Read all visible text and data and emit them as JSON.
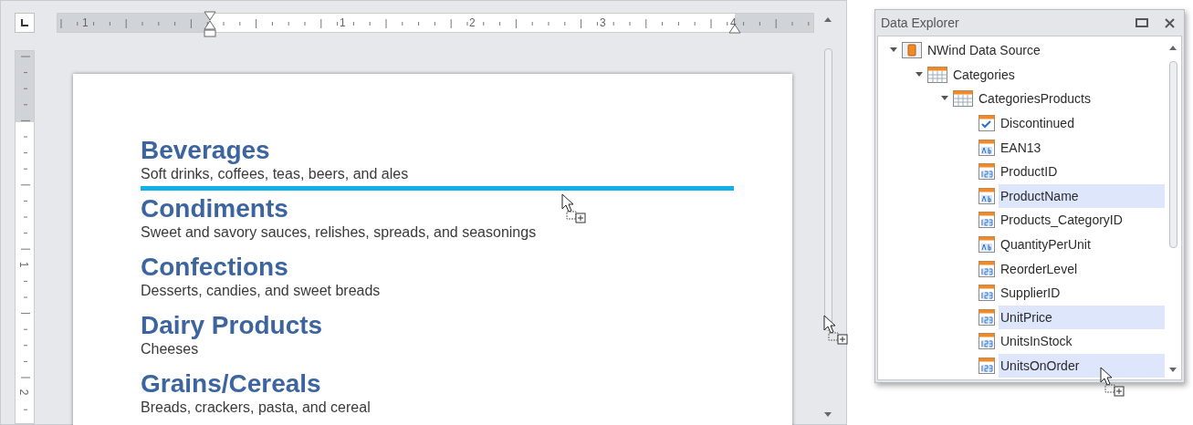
{
  "editor": {
    "ruler": {
      "labels": [
        "1",
        "1",
        "2",
        "3",
        "4"
      ]
    },
    "vertical_ruler": {
      "labels": [
        "1",
        "2"
      ]
    },
    "categories": [
      {
        "name": "Beverages",
        "description": "Soft drinks, coffees, teas, beers, and ales",
        "drop_target": true
      },
      {
        "name": "Condiments",
        "description": "Sweet and savory sauces, relishes, spreads, and seasonings",
        "drop_target": false
      },
      {
        "name": "Confections",
        "description": "Desserts, candies, and sweet breads",
        "drop_target": false
      },
      {
        "name": "Dairy Products",
        "description": "Cheeses",
        "drop_target": false
      },
      {
        "name": "Grains/Cereals",
        "description": "Breads, crackers, pasta, and cereal",
        "drop_target": false
      }
    ]
  },
  "data_explorer": {
    "title": "Data Explorer",
    "tree": [
      {
        "label": "NWind Data Source",
        "kind": "source",
        "expanded": true,
        "selected": false,
        "children": [
          {
            "label": "Categories",
            "kind": "table",
            "expanded": true,
            "selected": false,
            "children": [
              {
                "label": "CategoriesProducts",
                "kind": "table",
                "expanded": true,
                "selected": false,
                "children": [
                  {
                    "label": "Discontinued",
                    "kind": "boolean",
                    "selected": false
                  },
                  {
                    "label": "EAN13",
                    "kind": "string",
                    "selected": false
                  },
                  {
                    "label": "ProductID",
                    "kind": "number",
                    "selected": false
                  },
                  {
                    "label": "ProductName",
                    "kind": "string",
                    "selected": true
                  },
                  {
                    "label": "Products_CategoryID",
                    "kind": "number",
                    "selected": false
                  },
                  {
                    "label": "QuantityPerUnit",
                    "kind": "string",
                    "selected": false
                  },
                  {
                    "label": "ReorderLevel",
                    "kind": "number",
                    "selected": false
                  },
                  {
                    "label": "SupplierID",
                    "kind": "number",
                    "selected": false
                  },
                  {
                    "label": "UnitPrice",
                    "kind": "number",
                    "selected": true
                  },
                  {
                    "label": "UnitsInStock",
                    "kind": "number",
                    "selected": false
                  },
                  {
                    "label": "UnitsOnOrder",
                    "kind": "number",
                    "selected": true
                  }
                ]
              }
            ]
          }
        ]
      }
    ]
  }
}
